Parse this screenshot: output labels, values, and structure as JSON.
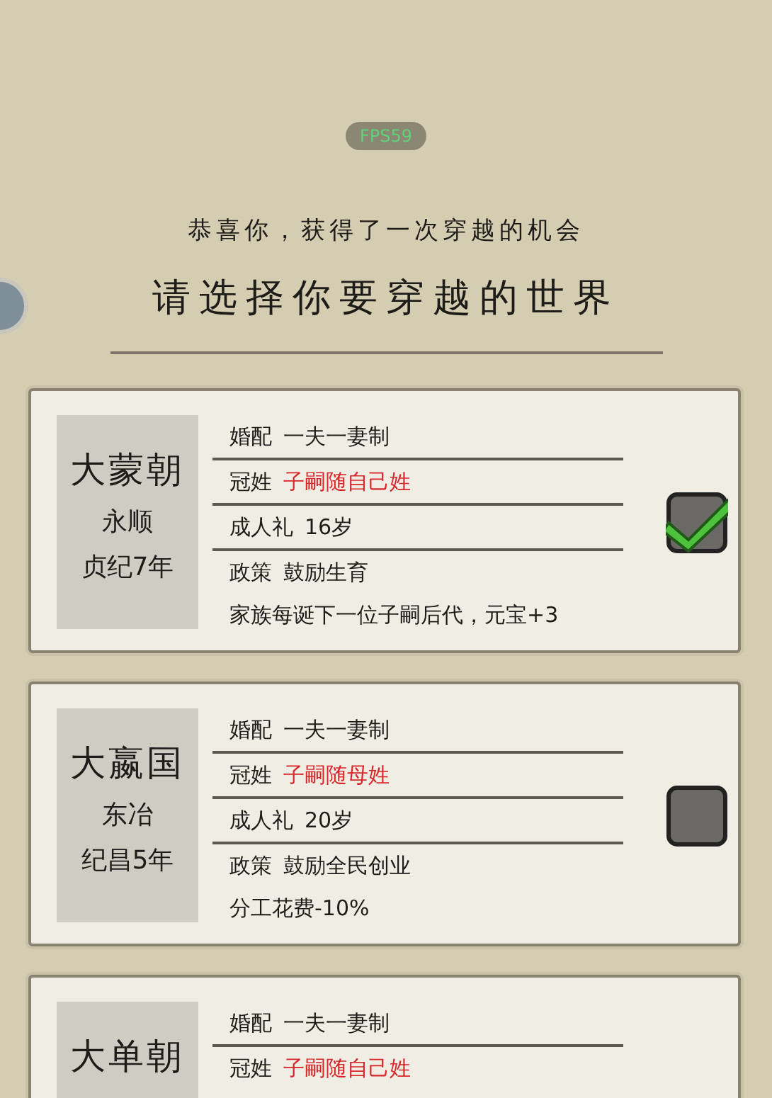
{
  "fps": "FPS59",
  "subtitle": "恭喜你，获得了一次穿越的机会",
  "title": "请选择你要穿越的世界",
  "worlds": [
    {
      "name": "大蒙朝",
      "era": "永顺",
      "year": "贞纪7年",
      "checked": true,
      "rows": [
        {
          "label": "婚配",
          "value": "一夫一妻制",
          "highlight": false
        },
        {
          "label": "冠姓",
          "value": "子嗣随自己姓",
          "highlight": true
        },
        {
          "label": "成人礼",
          "value": "16岁",
          "highlight": false
        },
        {
          "label": "政策",
          "value": "鼓励生育",
          "highlight": false
        }
      ],
      "note": "家族每诞下一位子嗣后代，元宝+3"
    },
    {
      "name": "大嬴国",
      "era": "东冶",
      "year": "纪昌5年",
      "checked": false,
      "rows": [
        {
          "label": "婚配",
          "value": "一夫一妻制",
          "highlight": false
        },
        {
          "label": "冠姓",
          "value": "子嗣随母姓",
          "highlight": true
        },
        {
          "label": "成人礼",
          "value": "20岁",
          "highlight": false
        },
        {
          "label": "政策",
          "value": "鼓励全民创业",
          "highlight": false
        }
      ],
      "note": "分工花费-10%"
    },
    {
      "name": "大单朝",
      "rows": [
        {
          "label": "婚配",
          "value": "一夫一妻制",
          "highlight": false
        },
        {
          "label": "冠姓",
          "value": "子嗣随自己姓",
          "highlight": true
        }
      ]
    }
  ]
}
